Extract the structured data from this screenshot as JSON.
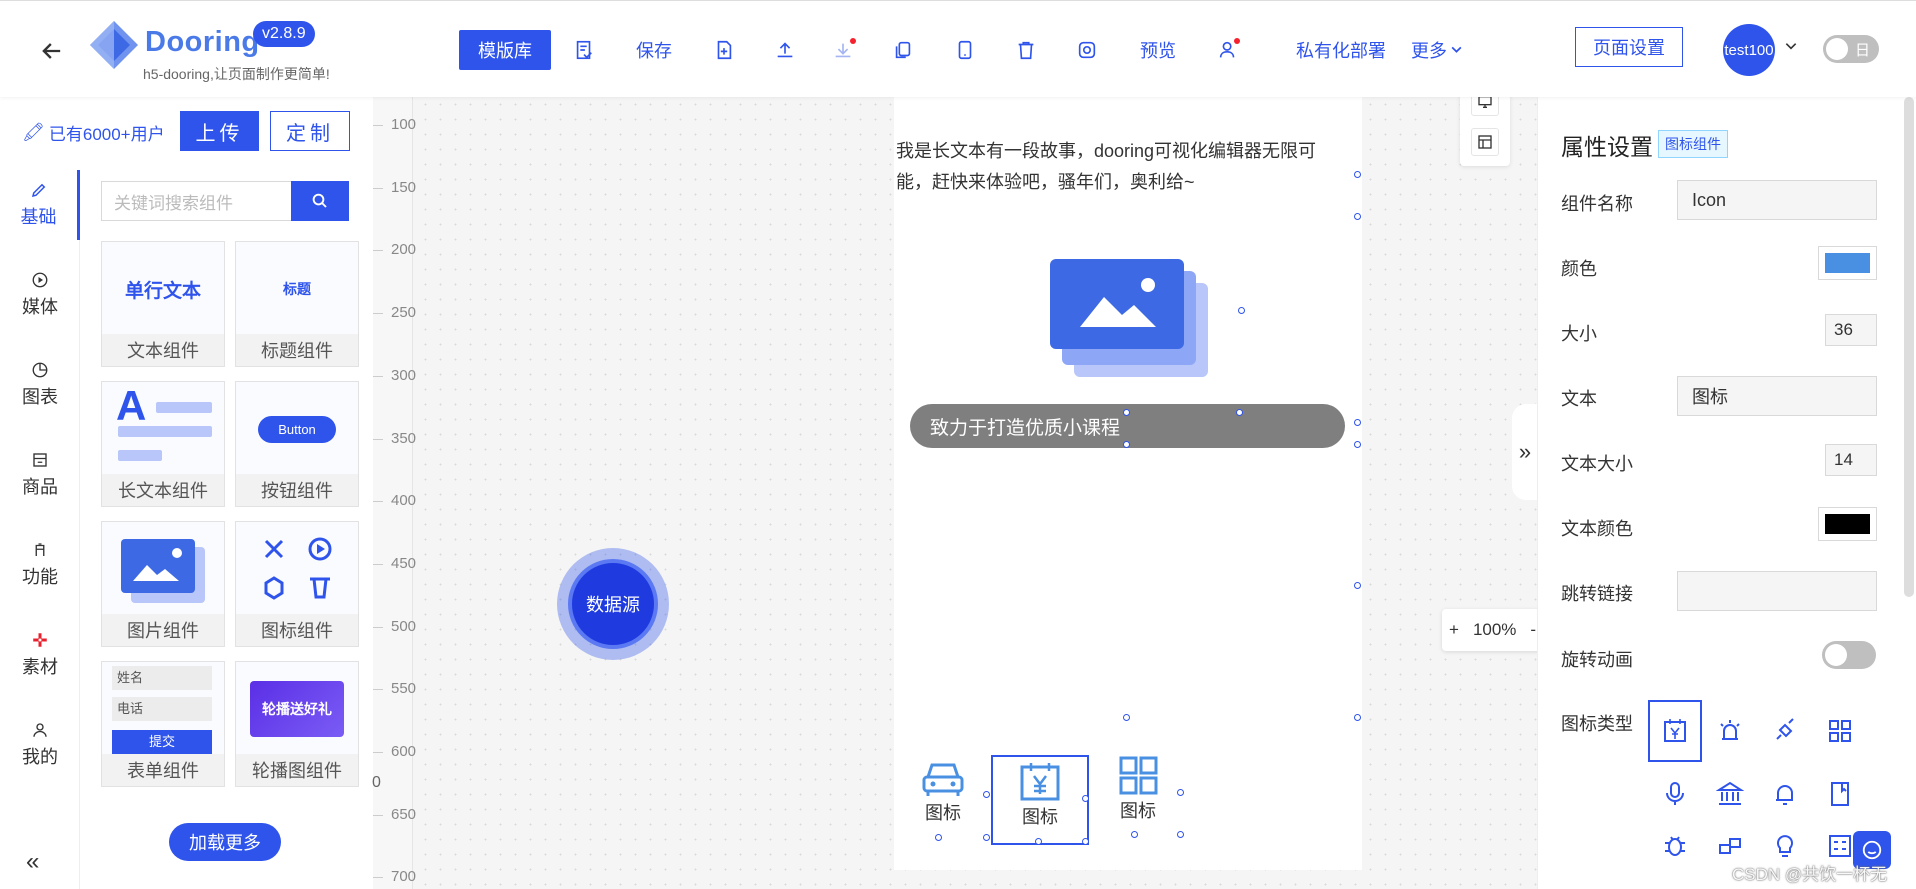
{
  "header": {
    "logo_text": "Dooring",
    "version": "v2.8.9",
    "slogan": "h5-dooring,让页面制作更简单!",
    "template_btn": "模版库",
    "save_label": "保存",
    "preview_label": "预览",
    "private_deploy_label": "私有化部署",
    "more_label": "更多",
    "page_settings_btn": "页面设置",
    "avatar_text": "test100",
    "theme_toggle_label": "日"
  },
  "left": {
    "users_badge": "已有6000+用户",
    "upload_btn": "上传",
    "custom_btn": "定制",
    "search_placeholder": "关键词搜索组件",
    "nav": [
      {
        "label": "基础",
        "icon": "pen-icon"
      },
      {
        "label": "媒体",
        "icon": "play-circle-icon"
      },
      {
        "label": "图表",
        "icon": "pie-chart-icon"
      },
      {
        "label": "商品",
        "icon": "shop-icon"
      },
      {
        "label": "功能",
        "icon": "function-icon"
      },
      {
        "label": "素材",
        "icon": "material-icon"
      },
      {
        "label": "我的",
        "icon": "user-icon"
      }
    ],
    "components": [
      {
        "label": "文本组件",
        "preview": "单行文本"
      },
      {
        "label": "标题组件",
        "preview": "标题"
      },
      {
        "label": "长文本组件",
        "preview": "A"
      },
      {
        "label": "按钮组件",
        "preview": "Button"
      },
      {
        "label": "图片组件",
        "preview": ""
      },
      {
        "label": "图标组件",
        "preview": ""
      },
      {
        "label": "表单组件",
        "preview": "",
        "form_name": "姓名",
        "form_phone": "电话",
        "form_submit": "提交"
      },
      {
        "label": "轮播图组件",
        "preview": "轮播送好礼"
      }
    ],
    "load_more": "加载更多",
    "collapse_glyph": "«"
  },
  "canvas": {
    "ruler_labels": [
      "100",
      "150",
      "200",
      "250",
      "300",
      "350",
      "400",
      "450",
      "500",
      "550",
      "600",
      "650",
      "700"
    ],
    "ruler_zero": "0",
    "data_source": "数据源",
    "long_text": "我是长文本有一段故事，dooring可视化编辑器无限可能，赶快来体验吧，骚年们，奥利给~",
    "notice_text": "致力于打造优质小课程",
    "bottom_icons": [
      {
        "label": "图标",
        "icon": "car-icon"
      },
      {
        "label": "图标",
        "icon": "calendar-yen-icon"
      },
      {
        "label": "图标",
        "icon": "appstore-icon"
      }
    ],
    "expand_glyph": "»",
    "zoom": {
      "plus": "+",
      "value": "100%",
      "minus": "-"
    }
  },
  "props": {
    "title": "属性设置",
    "tag": "图标组件",
    "name_label": "组件名称",
    "name_value": "Icon",
    "color_label": "颜色",
    "color_value": "#4a90e2",
    "size_label": "大小",
    "size_value": "36",
    "text_label": "文本",
    "text_value": "图标",
    "text_size_label": "文本大小",
    "text_size_value": "14",
    "text_color_label": "文本颜色",
    "text_color_value": "#000000",
    "link_label": "跳转链接",
    "link_value": "",
    "rotate_label": "旋转动画",
    "rotate_on": false,
    "icon_type_label": "图标类型",
    "icon_options": [
      "calendar-yen-icon",
      "alarm-icon",
      "api-icon",
      "appstore-icon",
      "audio-icon",
      "bank-icon",
      "bell-icon",
      "book-icon",
      "bug-icon",
      "build-icon",
      "bulb-icon",
      "calculator-icon"
    ]
  },
  "colors": {
    "accent": "#2f54eb",
    "notice_bg": "#7f7f7f"
  },
  "watermark": "CSDN @共饮一杯无"
}
